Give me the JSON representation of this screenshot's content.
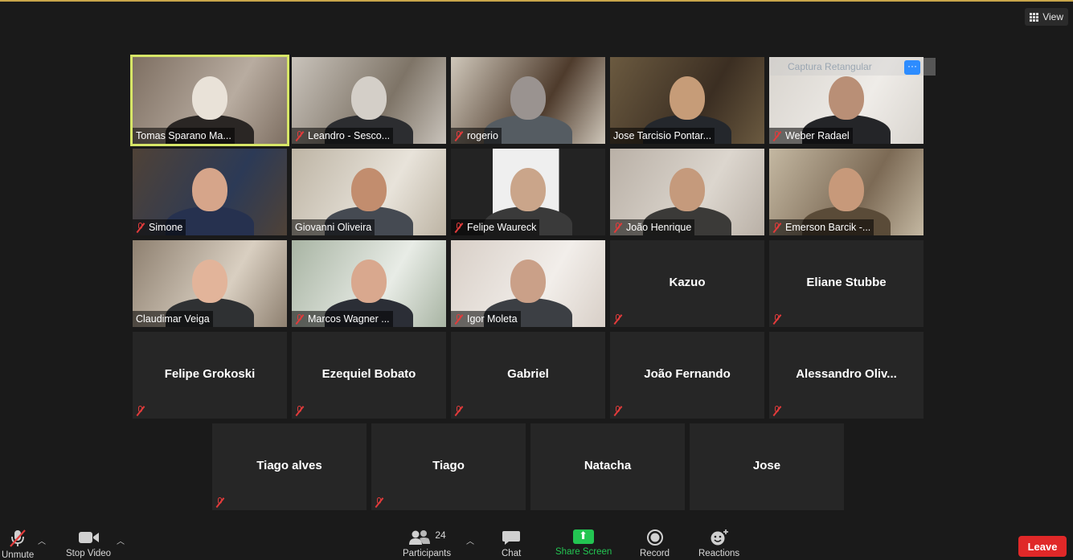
{
  "window": {
    "view_label": "View"
  },
  "overlay": {
    "capture_label": "Captura Retangular",
    "more_label": "···"
  },
  "participants": [
    {
      "name": "Tomas Sparano Ma...",
      "video": true,
      "muted": false,
      "active": true
    },
    {
      "name": "Leandro - Sesco...",
      "video": true,
      "muted": true
    },
    {
      "name": "rogerio",
      "video": true,
      "muted": true
    },
    {
      "name": "Jose Tarcisio Pontar...",
      "video": true,
      "muted": false
    },
    {
      "name": "Weber Radael",
      "video": true,
      "muted": true
    },
    {
      "name": "Simone",
      "video": true,
      "muted": true
    },
    {
      "name": "Giovanni Oliveira",
      "video": true,
      "muted": false
    },
    {
      "name": "Felipe Waureck",
      "video": true,
      "muted": true
    },
    {
      "name": "João Henrique",
      "video": true,
      "muted": true
    },
    {
      "name": "Emerson Barcik -...",
      "video": true,
      "muted": true
    },
    {
      "name": "Claudimar Veiga",
      "video": true,
      "muted": false
    },
    {
      "name": "Marcos Wagner ...",
      "video": true,
      "muted": true
    },
    {
      "name": "Igor Moleta",
      "video": true,
      "muted": true
    },
    {
      "name": "Kazuo",
      "video": false,
      "muted": true
    },
    {
      "name": "Eliane Stubbe",
      "video": false,
      "muted": true
    },
    {
      "name": "Felipe Grokoski",
      "video": false,
      "muted": true
    },
    {
      "name": "Ezequiel Bobato",
      "video": false,
      "muted": true
    },
    {
      "name": "Gabriel",
      "video": false,
      "muted": true
    },
    {
      "name": "João Fernando",
      "video": false,
      "muted": true
    },
    {
      "name": "Alessandro  Oliv...",
      "video": false,
      "muted": true
    },
    {
      "name": "Tiago alves",
      "video": false,
      "muted": true
    },
    {
      "name": "Tiago",
      "video": false,
      "muted": true
    },
    {
      "name": "Natacha",
      "video": false,
      "muted": false
    },
    {
      "name": "Jose",
      "video": false,
      "muted": false
    }
  ],
  "toolbar": {
    "unmute": "Unmute",
    "stop_video": "Stop Video",
    "participants": "Participants",
    "participants_count": "24",
    "chat": "Chat",
    "share_screen": "Share Screen",
    "record": "Record",
    "reactions": "Reactions",
    "leave": "Leave"
  },
  "colors": {
    "active_speaker": "#d7e667",
    "share_green": "#23c552",
    "leave_red": "#e02828",
    "mute_red": "#e23b3b"
  }
}
